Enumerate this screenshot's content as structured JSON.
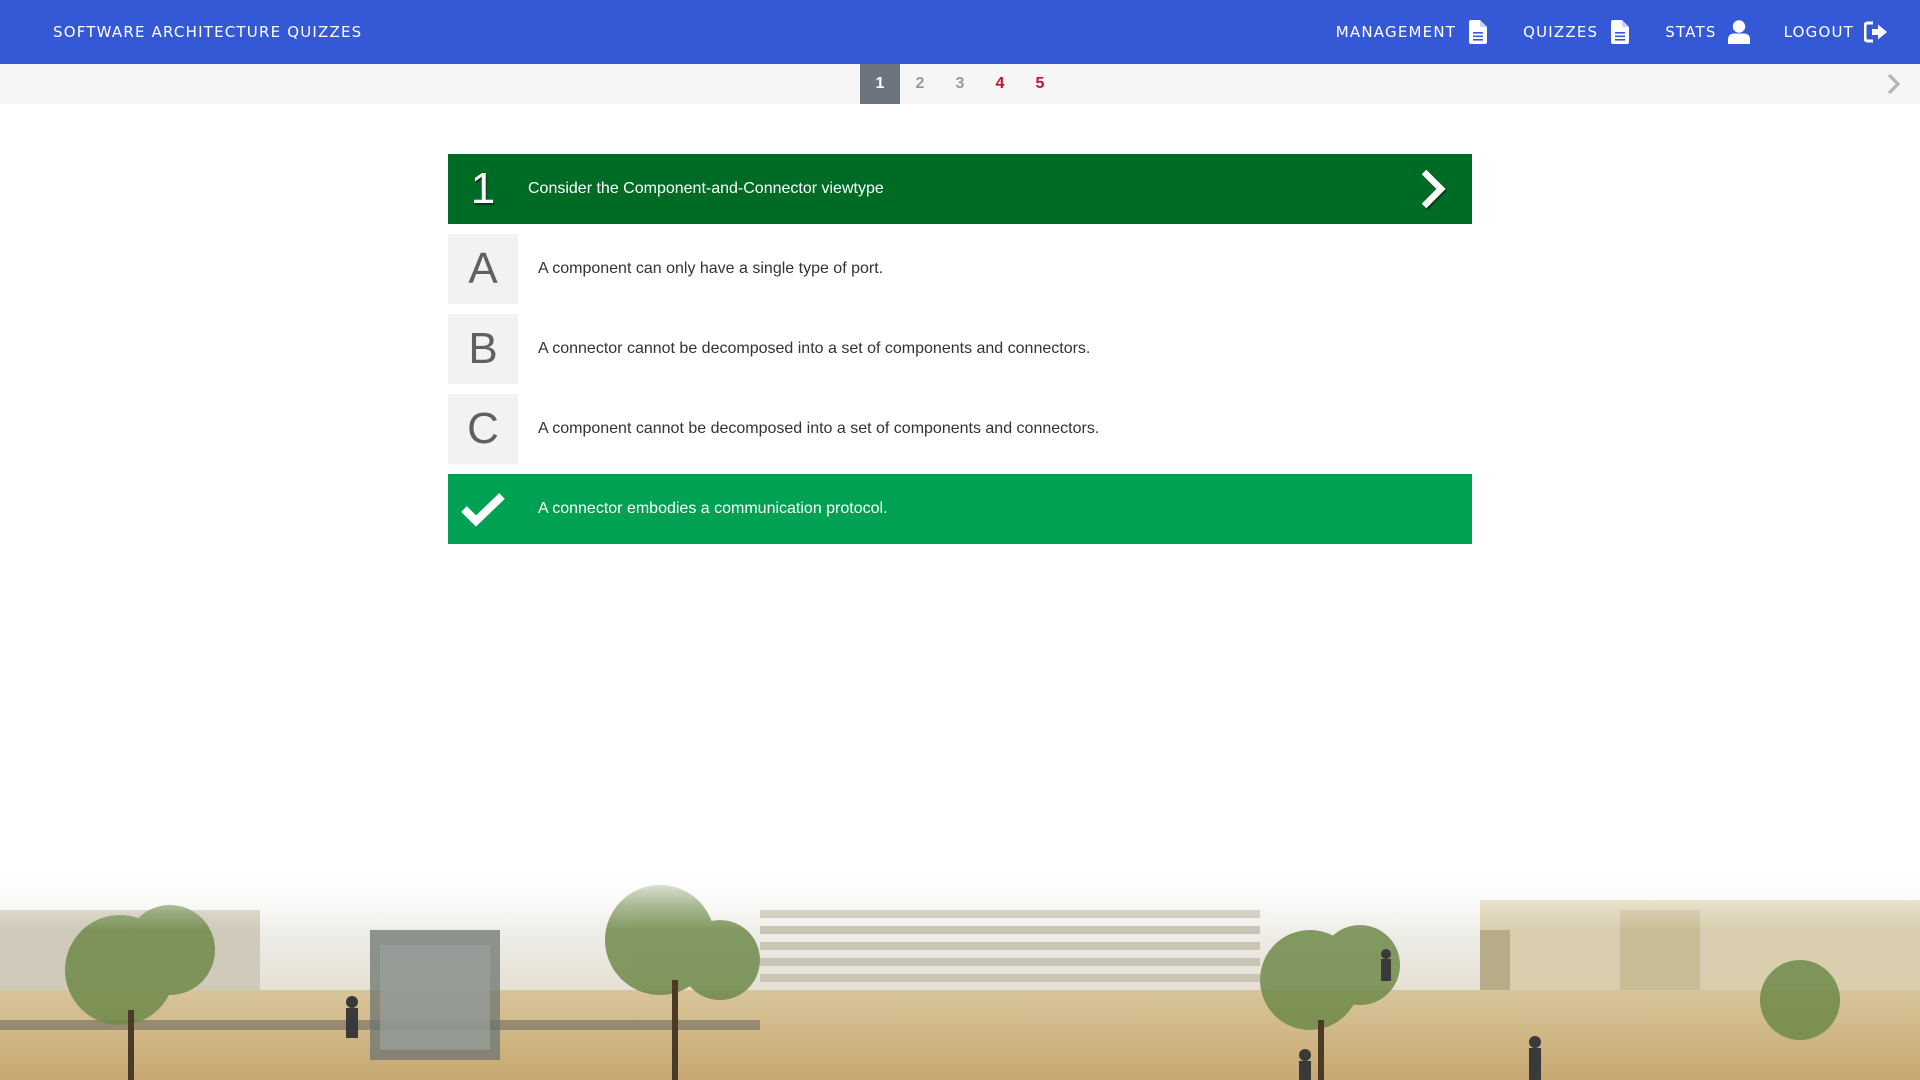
{
  "colors": {
    "navbar": "#3559d6",
    "question_header": "#006b25",
    "correct_answer": "#00a152",
    "page_current_bg": "#6c7480",
    "page_unvisited": "#9a9a9a",
    "page_wrong": "#c8102e"
  },
  "navbar": {
    "brand": "SOFTWARE ARCHITECTURE QUIZZES",
    "items": [
      {
        "label": "MANAGEMENT",
        "icon": "file-icon"
      },
      {
        "label": "QUIZZES",
        "icon": "file-icon"
      },
      {
        "label": "STATS",
        "icon": "user-icon"
      },
      {
        "label": "LOGOUT",
        "icon": "logout-icon"
      }
    ]
  },
  "pagination": {
    "pages": [
      {
        "label": "1",
        "state": "current"
      },
      {
        "label": "2",
        "state": "unvisited"
      },
      {
        "label": "3",
        "state": "unvisited"
      },
      {
        "label": "4",
        "state": "wrong"
      },
      {
        "label": "5",
        "state": "wrong"
      }
    ],
    "next_icon": "chevron-right-icon"
  },
  "question": {
    "number": "1",
    "text": "Consider the Component-and-Connector viewtype",
    "next_icon": "chevron-right-icon",
    "answers": [
      {
        "letter": "A",
        "text": "A component can only have a single type of port.",
        "correct": false
      },
      {
        "letter": "B",
        "text": "A connector cannot be decomposed into a set of components and connectors.",
        "correct": false
      },
      {
        "letter": "C",
        "text": "A component cannot be decomposed into a set of components and connectors.",
        "correct": false
      },
      {
        "letter": "",
        "text": "A connector embodies a communication protocol.",
        "correct": true,
        "icon": "checkmark-icon"
      }
    ]
  },
  "footer": {
    "image": "campus-photo"
  }
}
